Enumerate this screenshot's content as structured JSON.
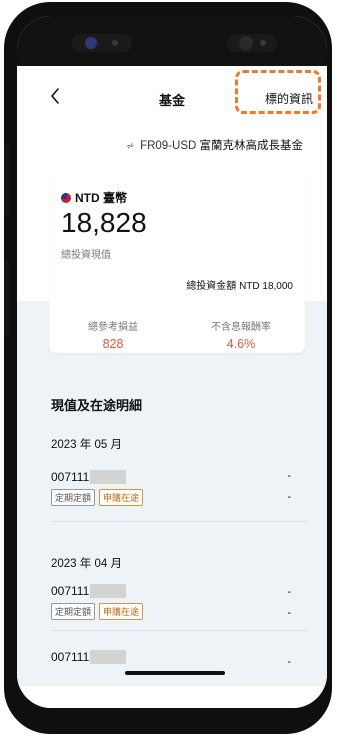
{
  "nav": {
    "back_icon": "chevron-left-icon",
    "title": "基金",
    "right_link": "標的資訊"
  },
  "fund": {
    "icon": "fund-icon",
    "code": "FR09-USD",
    "name": "富蘭克林高成長基金"
  },
  "summary": {
    "currency_label": "NTD 臺幣",
    "current_value": "18,828",
    "current_value_label": "總投資現值",
    "total_invested_label": "總投資金額",
    "total_invested_value": "NTD 18,000",
    "profit_label": "總參考損益",
    "profit_value": "828",
    "return_label": "不含息報酬率",
    "return_value": "4.6%"
  },
  "details": {
    "section_title": "現值及在途明細",
    "groups": [
      {
        "month": "2023 年 05 月",
        "items": [
          {
            "id": "007111",
            "tags": [
              "定期定額",
              "申購在途"
            ],
            "value1": "-",
            "value2": "-"
          }
        ]
      },
      {
        "month": "2023 年 04 月",
        "items": [
          {
            "id": "007111",
            "tags": [
              "定期定額",
              "申購在途"
            ],
            "value1": "-",
            "value2": "-"
          },
          {
            "id": "007111",
            "tags": [],
            "value1": "-",
            "value2": ""
          }
        ]
      }
    ]
  },
  "colors": {
    "accent_red": "#e8563a",
    "highlight_orange": "#ee7a2b",
    "tag_orange": "#b86d10"
  }
}
